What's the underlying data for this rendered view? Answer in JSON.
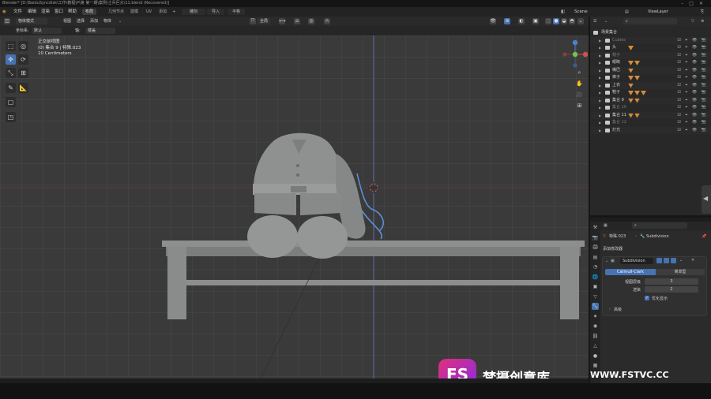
{
  "titlebar": {
    "text": "Blender* [D:\\BaiduSyncdisk\\工作\\教程\\P\\第 第一期\\案例\\士兵巨大\\11.blend (Recovered)]"
  },
  "menubar": {
    "menus": [
      "文件",
      "编辑",
      "渲染",
      "窗口",
      "帮助"
    ],
    "workspaces": [
      "布局",
      "几何节点",
      "建模",
      "UV",
      "添加"
    ],
    "active_workspace": "布局",
    "mid_buttons": [
      "雕刻",
      "导入",
      "平移"
    ],
    "scene_label": "Scene",
    "viewlayer_label": "ViewLayer"
  },
  "header": {
    "editor_icon": "cube-icon",
    "mode": "物体模式",
    "menus": [
      "视图",
      "选择",
      "添加",
      "物体"
    ],
    "orientation_label": "全局",
    "row2": {
      "coords_label": "坐标系:",
      "coords_value": "默认",
      "pivot_label": "轴:",
      "pivot_value": "楼盖"
    }
  },
  "viewport": {
    "view_name": "正交前视图",
    "collection_info": "(0) 集合 9 | 特殊.023",
    "scale_info": "10 Centimeters"
  },
  "outliner": {
    "search_placeholder": "",
    "rows": [
      {
        "label": "场景集合",
        "dim": false,
        "mods": 0
      },
      {
        "label": "Cubies",
        "dim": true,
        "mods": 0
      },
      {
        "label": "头",
        "dim": false,
        "mods": 1
      },
      {
        "label": "帽子",
        "dim": true,
        "mods": 0
      },
      {
        "label": "眼睛",
        "dim": false,
        "mods": 2
      },
      {
        "label": "嘴巴",
        "dim": false,
        "mods": 1
      },
      {
        "label": "裤子",
        "dim": false,
        "mods": 2
      },
      {
        "label": "上衣",
        "dim": false,
        "mods": 1
      },
      {
        "label": "鞋子",
        "dim": false,
        "mods": 3
      },
      {
        "label": "集合 9",
        "dim": false,
        "mods": 2
      },
      {
        "label": "集合 10",
        "dim": true,
        "mods": 0
      },
      {
        "label": "集合 11",
        "dim": false,
        "mods": 2
      },
      {
        "label": "集合 12",
        "dim": true,
        "mods": 0
      },
      {
        "label": "灯光",
        "dim": false,
        "mods": 0
      }
    ]
  },
  "properties": {
    "breadcrumb_object": "特殊.023",
    "breadcrumb_modifier": "Subdivision",
    "add_modifier": "添加修改器",
    "modifier_name": "Subdivision",
    "tab_catmull": "Catmull-Clark",
    "tab_simple": "简单型",
    "levels_viewport_label": "视图层级",
    "levels_viewport_value": "3",
    "render_label": "渲染",
    "render_value": "2",
    "optimal_label": "优化显示",
    "advanced_label": "高级"
  },
  "watermark": {
    "brand": "梵摄创意库",
    "url": "WWW.FSTVC.CC",
    "logo_letters": "FS"
  },
  "colors": {
    "accent": "#4772b3",
    "modifier_orange": "#d48a3c",
    "bezier": "#5b8fd6"
  }
}
